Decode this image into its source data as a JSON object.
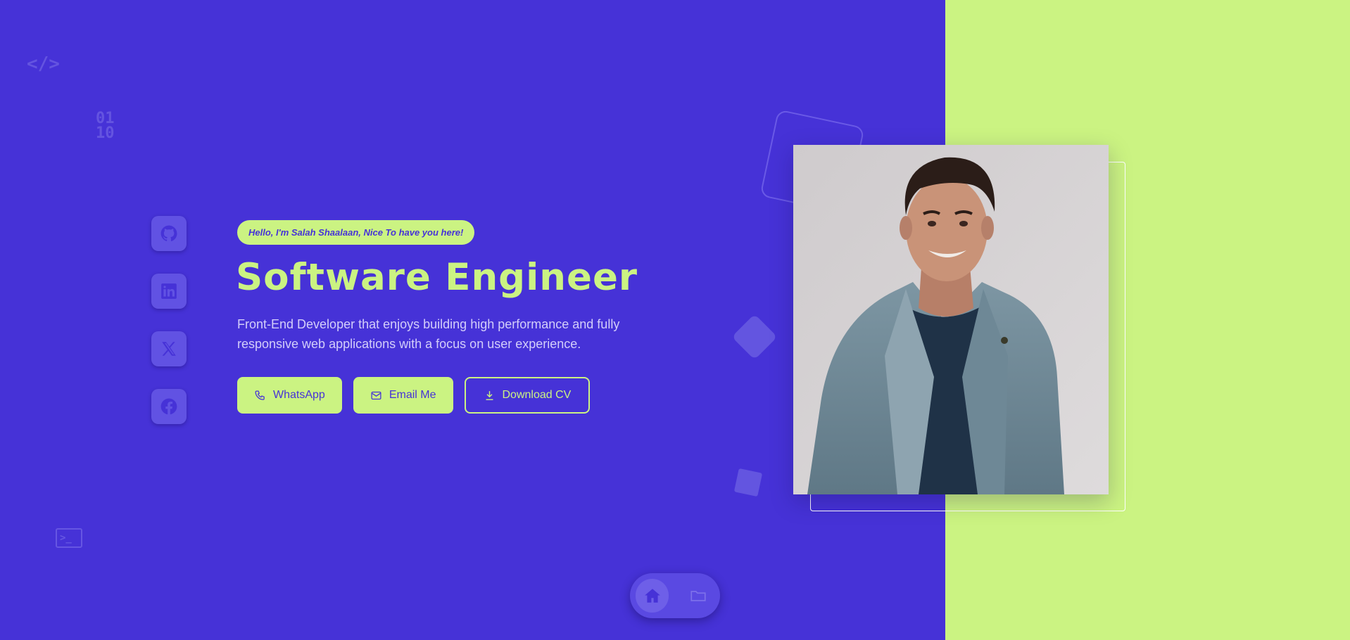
{
  "colors": {
    "primary": "#4632d7",
    "accent": "#cbf382",
    "panel_right": "#cbf382"
  },
  "decor": {
    "code_symbol": "</>",
    "binary_line_1": "01",
    "binary_line_2": "10",
    "terminal_prompt": ">_"
  },
  "social": [
    {
      "name": "GitHub",
      "icon": "github-icon"
    },
    {
      "name": "LinkedIn",
      "icon": "linkedin-icon"
    },
    {
      "name": "X",
      "icon": "x-icon"
    },
    {
      "name": "Facebook",
      "icon": "facebook-icon"
    }
  ],
  "hero": {
    "greeting": "Hello, I'm Salah Shaalaan, Nice To have you here!",
    "title": "Software Engineer",
    "description": "Front-End Developer that enjoys building high performance and fully responsive web applications with a focus on user experience."
  },
  "actions": {
    "whatsapp_label": "WhatsApp",
    "email_label": "Email Me",
    "download_label": "Download CV"
  },
  "dock": {
    "items": [
      {
        "name": "home",
        "icon": "home-icon",
        "active": true
      },
      {
        "name": "projects",
        "icon": "folder-icon",
        "active": false
      }
    ]
  }
}
